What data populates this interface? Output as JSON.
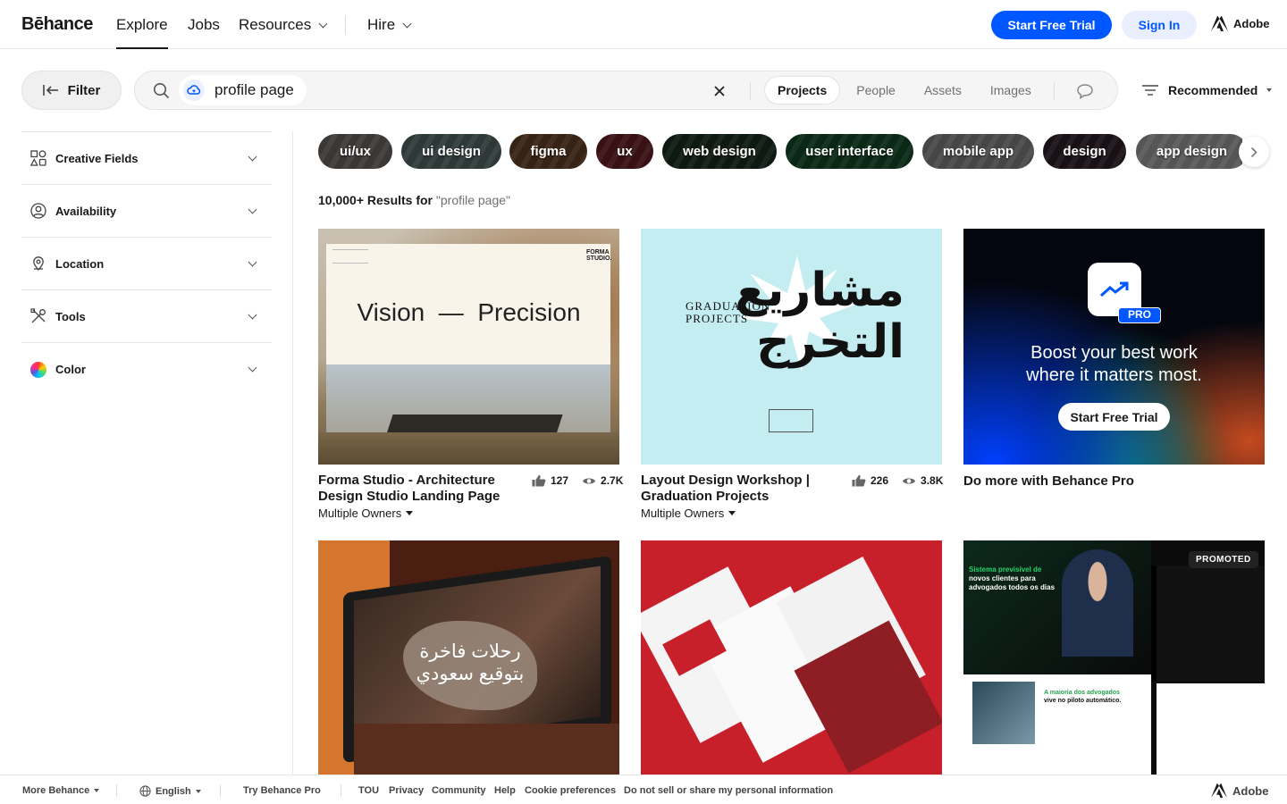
{
  "nav": {
    "logo": "Bēhance",
    "explore": "Explore",
    "jobs": "Jobs",
    "resources": "Resources",
    "hire": "Hire",
    "start_trial": "Start Free Trial",
    "sign_in": "Sign In",
    "adobe": "Adobe"
  },
  "search": {
    "filter_label": "Filter",
    "query": "profile page",
    "tabs": [
      "Projects",
      "People",
      "Assets",
      "Images"
    ],
    "selected_tab": "Projects",
    "sort_label": "Recommended"
  },
  "sidebar": {
    "items": [
      {
        "label": "Creative Fields",
        "icon": "shapes-icon"
      },
      {
        "label": "Availability",
        "icon": "person-circle-icon"
      },
      {
        "label": "Location",
        "icon": "location-pin-icon"
      },
      {
        "label": "Tools",
        "icon": "tools-icon"
      },
      {
        "label": "Color",
        "icon": "color-wheel-icon"
      }
    ]
  },
  "tags": [
    "ui/ux",
    "ui design",
    "figma",
    "ux",
    "web design",
    "user interface",
    "mobile app",
    "design",
    "app design"
  ],
  "results": {
    "count_text": "10,000+ Results for ",
    "query_text": "\"profile page\""
  },
  "cards": [
    {
      "title_line1": "Forma Studio - Architecture",
      "title_line2": "Design Studio Landing Page",
      "owner": "Multiple Owners",
      "likes": "127",
      "views": "2.7K",
      "img_headline": "Vision  —  Precision",
      "img_logo": "FORMA STUDIO."
    },
    {
      "title_line1": "Layout Design Workshop |",
      "title_line2": "Graduation Projects",
      "owner": "Multiple Owners",
      "likes": "226",
      "views": "3.8K",
      "img_en": "GRADUATION PROJECTS",
      "img_ar": "مشاريع التخرج"
    },
    {
      "title": "Do more with Behance Pro",
      "pro_badge": "PRO",
      "headline_line1": "Boost your best work",
      "headline_line2": "where it matters most.",
      "cta": "Start Free Trial"
    },
    {
      "img_ar_line1": "رحلات فاخرة",
      "img_ar_line2": "بتوقيع سعودي"
    },
    {},
    {
      "badge": "PROMOTED",
      "line1": "Sistema previsível de",
      "line2": "novos clientes para",
      "line3": "advogados todos os dias",
      "line4": "A maioria dos advogados",
      "line5": "vive no piloto automático."
    }
  ],
  "footer": {
    "more": "More Behance",
    "language": "English",
    "try_pro": "Try Behance Pro",
    "links": [
      "TOU",
      "Privacy",
      "Community",
      "Help",
      "Cookie preferences",
      "Do not sell or share my personal information"
    ],
    "adobe": "Adobe"
  },
  "colors": {
    "brand_blue": "#0057ff",
    "sign_in_bg": "#e9efff",
    "text": "#191919",
    "muted": "#707070"
  }
}
